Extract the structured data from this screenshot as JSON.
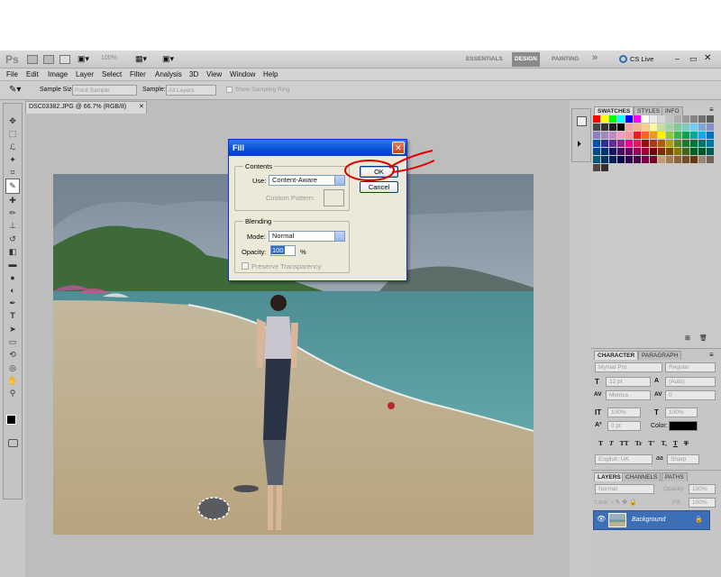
{
  "app": {
    "logo": "Ps",
    "zoom": "100%",
    "workspaces": [
      "ESSENTIALS",
      "DESIGN",
      "PAINTING"
    ],
    "active_workspace": "DESIGN",
    "more": "»",
    "cs_live": "CS Live"
  },
  "menu": [
    "File",
    "Edit",
    "Image",
    "Layer",
    "Select",
    "Filter",
    "Analysis",
    "3D",
    "View",
    "Window",
    "Help"
  ],
  "options": {
    "sample_size_label": "Sample Size:",
    "sample_size_value": "Point Sample",
    "sample_label": "Sample:",
    "sample_value": "All Layers",
    "show_ring": "Show Sampling Ring"
  },
  "document": {
    "tab_title": "DSC03382.JPG @ 66.7% (RGB/8)"
  },
  "fill_dialog": {
    "title": "Fill",
    "contents_label": "Contents",
    "use_label": "Use:",
    "use_value": "Content-Aware",
    "custom_pattern_label": "Custom Pattern:",
    "blending_label": "Blending",
    "mode_label": "Mode:",
    "mode_value": "Normal",
    "opacity_label": "Opacity:",
    "opacity_value": "100",
    "opacity_unit": "%",
    "preserve_label": "Preserve Transparency",
    "ok_label": "OK",
    "cancel_label": "Cancel"
  },
  "swatches_panel": {
    "tabs": [
      "SWATCHES",
      "STYLES",
      "INFO"
    ],
    "colors": [
      "#ff0000",
      "#ffff00",
      "#00ff00",
      "#00ffff",
      "#0000ff",
      "#ff00ff",
      "#ffffff",
      "#ebebeb",
      "#d6d6d6",
      "#c2c2c2",
      "#adadad",
      "#999999",
      "#858585",
      "#707070",
      "#5c5c5c",
      "#474747",
      "#333333",
      "#1f1f1f",
      "#000000",
      "#f2a2a2",
      "#f5b48c",
      "#f8cf8c",
      "#fff799",
      "#c4df9b",
      "#a3d39c",
      "#82ca9c",
      "#7accc8",
      "#6dcff6",
      "#7da7d9",
      "#8393ca",
      "#8781bd",
      "#a187be",
      "#bd8cbf",
      "#f49ac2",
      "#f6989d",
      "#ed1c24",
      "#f26522",
      "#f7941d",
      "#fff200",
      "#8dc63f",
      "#39b54a",
      "#00a651",
      "#00a99d",
      "#00aeef",
      "#0072bc",
      "#0054a6",
      "#2e3192",
      "#662d91",
      "#92278f",
      "#ec008c",
      "#ed145b",
      "#9e0b0f",
      "#a0410d",
      "#a36209",
      "#aba000",
      "#598527",
      "#197b30",
      "#007236",
      "#00746b",
      "#0076a3",
      "#004b80",
      "#003471",
      "#1b1464",
      "#440e62",
      "#630460",
      "#9e005d",
      "#9e0039",
      "#790000",
      "#7b2e00",
      "#7d4900",
      "#827b00",
      "#406618",
      "#005e20",
      "#005826",
      "#005952",
      "#005b7f",
      "#003663",
      "#002157",
      "#0d004c",
      "#32004b",
      "#4b0049",
      "#7b0046",
      "#7a0026",
      "#c69c6d",
      "#a67c52",
      "#8c6239",
      "#754c24",
      "#603913",
      "#998675",
      "#736357",
      "#534741",
      "#362f2d"
    ]
  },
  "character_panel": {
    "tabs": [
      "CHARACTER",
      "PARAGRAPH"
    ],
    "font_family": "Myriad Pro",
    "font_style": "Regular",
    "size": "12 pt",
    "leading": "(Auto)",
    "kerning": "Metrics",
    "tracking": "0",
    "vscale": "100%",
    "hscale": "100%",
    "baseline": "0 pt",
    "color_label": "Color:",
    "type_styles": [
      "T",
      "T",
      "TT",
      "Tr",
      "T'",
      "T,",
      "T",
      "T"
    ],
    "language": "English: UK",
    "aa_label": "aa",
    "antialias": "Sharp"
  },
  "layers_panel": {
    "tabs": [
      "LAYERS",
      "CHANNELS",
      "PATHS"
    ],
    "blend_mode": "Normal",
    "opacity_label": "Opacity:",
    "opacity_value": "100%",
    "lock_label": "Lock:",
    "fill_label": "Fill:",
    "fill_value": "100%",
    "layers": [
      {
        "name": "Background"
      }
    ]
  }
}
